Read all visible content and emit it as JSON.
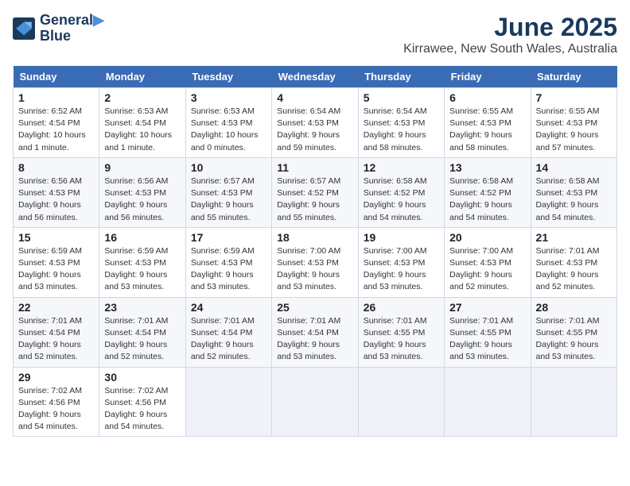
{
  "logo": {
    "line1": "General",
    "line2": "Blue"
  },
  "title": "June 2025",
  "subtitle": "Kirrawee, New South Wales, Australia",
  "headers": [
    "Sunday",
    "Monday",
    "Tuesday",
    "Wednesday",
    "Thursday",
    "Friday",
    "Saturday"
  ],
  "weeks": [
    [
      {
        "day": "1",
        "sunrise": "6:52 AM",
        "sunset": "4:54 PM",
        "daylight": "10 hours and 1 minute."
      },
      {
        "day": "2",
        "sunrise": "6:53 AM",
        "sunset": "4:54 PM",
        "daylight": "10 hours and 1 minute."
      },
      {
        "day": "3",
        "sunrise": "6:53 AM",
        "sunset": "4:53 PM",
        "daylight": "10 hours and 0 minutes."
      },
      {
        "day": "4",
        "sunrise": "6:54 AM",
        "sunset": "4:53 PM",
        "daylight": "9 hours and 59 minutes."
      },
      {
        "day": "5",
        "sunrise": "6:54 AM",
        "sunset": "4:53 PM",
        "daylight": "9 hours and 58 minutes."
      },
      {
        "day": "6",
        "sunrise": "6:55 AM",
        "sunset": "4:53 PM",
        "daylight": "9 hours and 58 minutes."
      },
      {
        "day": "7",
        "sunrise": "6:55 AM",
        "sunset": "4:53 PM",
        "daylight": "9 hours and 57 minutes."
      }
    ],
    [
      {
        "day": "8",
        "sunrise": "6:56 AM",
        "sunset": "4:53 PM",
        "daylight": "9 hours and 56 minutes."
      },
      {
        "day": "9",
        "sunrise": "6:56 AM",
        "sunset": "4:53 PM",
        "daylight": "9 hours and 56 minutes."
      },
      {
        "day": "10",
        "sunrise": "6:57 AM",
        "sunset": "4:53 PM",
        "daylight": "9 hours and 55 minutes."
      },
      {
        "day": "11",
        "sunrise": "6:57 AM",
        "sunset": "4:52 PM",
        "daylight": "9 hours and 55 minutes."
      },
      {
        "day": "12",
        "sunrise": "6:58 AM",
        "sunset": "4:52 PM",
        "daylight": "9 hours and 54 minutes."
      },
      {
        "day": "13",
        "sunrise": "6:58 AM",
        "sunset": "4:52 PM",
        "daylight": "9 hours and 54 minutes."
      },
      {
        "day": "14",
        "sunrise": "6:58 AM",
        "sunset": "4:53 PM",
        "daylight": "9 hours and 54 minutes."
      }
    ],
    [
      {
        "day": "15",
        "sunrise": "6:59 AM",
        "sunset": "4:53 PM",
        "daylight": "9 hours and 53 minutes."
      },
      {
        "day": "16",
        "sunrise": "6:59 AM",
        "sunset": "4:53 PM",
        "daylight": "9 hours and 53 minutes."
      },
      {
        "day": "17",
        "sunrise": "6:59 AM",
        "sunset": "4:53 PM",
        "daylight": "9 hours and 53 minutes."
      },
      {
        "day": "18",
        "sunrise": "7:00 AM",
        "sunset": "4:53 PM",
        "daylight": "9 hours and 53 minutes."
      },
      {
        "day": "19",
        "sunrise": "7:00 AM",
        "sunset": "4:53 PM",
        "daylight": "9 hours and 53 minutes."
      },
      {
        "day": "20",
        "sunrise": "7:00 AM",
        "sunset": "4:53 PM",
        "daylight": "9 hours and 52 minutes."
      },
      {
        "day": "21",
        "sunrise": "7:01 AM",
        "sunset": "4:53 PM",
        "daylight": "9 hours and 52 minutes."
      }
    ],
    [
      {
        "day": "22",
        "sunrise": "7:01 AM",
        "sunset": "4:54 PM",
        "daylight": "9 hours and 52 minutes."
      },
      {
        "day": "23",
        "sunrise": "7:01 AM",
        "sunset": "4:54 PM",
        "daylight": "9 hours and 52 minutes."
      },
      {
        "day": "24",
        "sunrise": "7:01 AM",
        "sunset": "4:54 PM",
        "daylight": "9 hours and 52 minutes."
      },
      {
        "day": "25",
        "sunrise": "7:01 AM",
        "sunset": "4:54 PM",
        "daylight": "9 hours and 53 minutes."
      },
      {
        "day": "26",
        "sunrise": "7:01 AM",
        "sunset": "4:55 PM",
        "daylight": "9 hours and 53 minutes."
      },
      {
        "day": "27",
        "sunrise": "7:01 AM",
        "sunset": "4:55 PM",
        "daylight": "9 hours and 53 minutes."
      },
      {
        "day": "28",
        "sunrise": "7:01 AM",
        "sunset": "4:55 PM",
        "daylight": "9 hours and 53 minutes."
      }
    ],
    [
      {
        "day": "29",
        "sunrise": "7:02 AM",
        "sunset": "4:56 PM",
        "daylight": "9 hours and 54 minutes."
      },
      {
        "day": "30",
        "sunrise": "7:02 AM",
        "sunset": "4:56 PM",
        "daylight": "9 hours and 54 minutes."
      },
      null,
      null,
      null,
      null,
      null
    ]
  ]
}
